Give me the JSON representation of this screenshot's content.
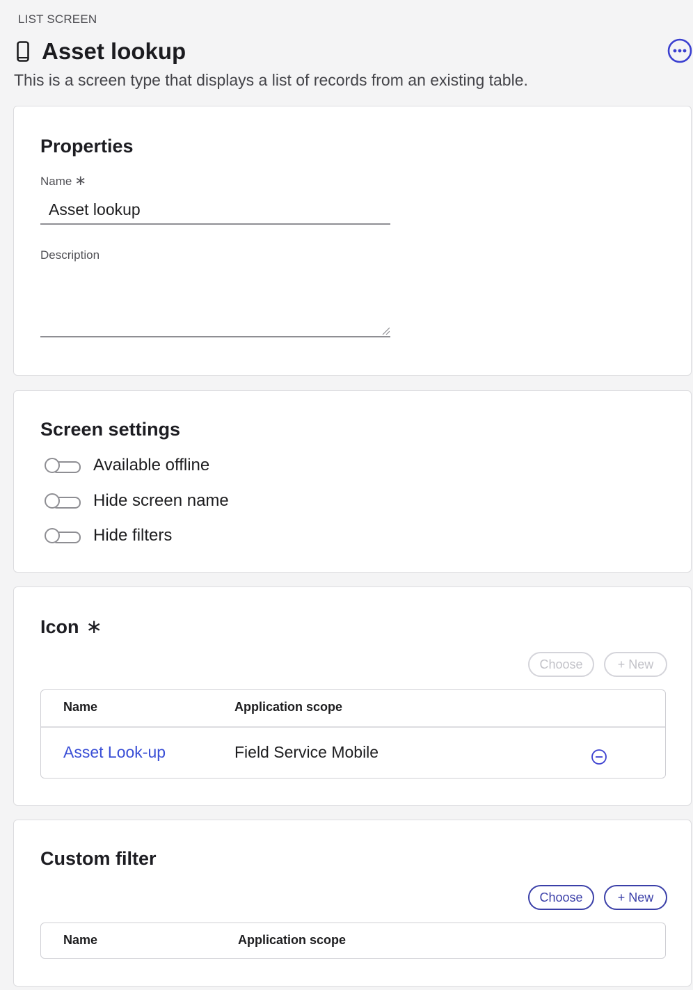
{
  "header": {
    "eyebrow": "LIST SCREEN",
    "title": "Asset lookup",
    "title_icon": "mobile-phone-icon",
    "more_icon": "more-options-icon",
    "subtitle": "This is a screen type that displays a list of records from an existing table."
  },
  "properties": {
    "heading": "Properties",
    "name_label": "Name",
    "name_value": "Asset lookup",
    "description_label": "Description",
    "description_value": ""
  },
  "screen_settings": {
    "heading": "Screen settings",
    "toggles": [
      {
        "label": "Available offline",
        "checked": false
      },
      {
        "label": "Hide screen name",
        "checked": false
      },
      {
        "label": "Hide filters",
        "checked": false
      }
    ]
  },
  "icon_section": {
    "heading": "Icon",
    "choose_label": "Choose",
    "new_label": "+ New",
    "columns": [
      "Name",
      "Application scope"
    ],
    "rows": [
      {
        "name": "Asset Look-up",
        "scope": "Field Service Mobile"
      }
    ]
  },
  "custom_filter": {
    "heading": "Custom filter",
    "choose_label": "Choose",
    "new_label": "+ New",
    "columns": [
      "Name",
      "Application scope"
    ],
    "rows": []
  },
  "colors": {
    "accent": "#3a3fa8",
    "link": "#3a4fd6",
    "page_bg": "#f4f4f5"
  }
}
